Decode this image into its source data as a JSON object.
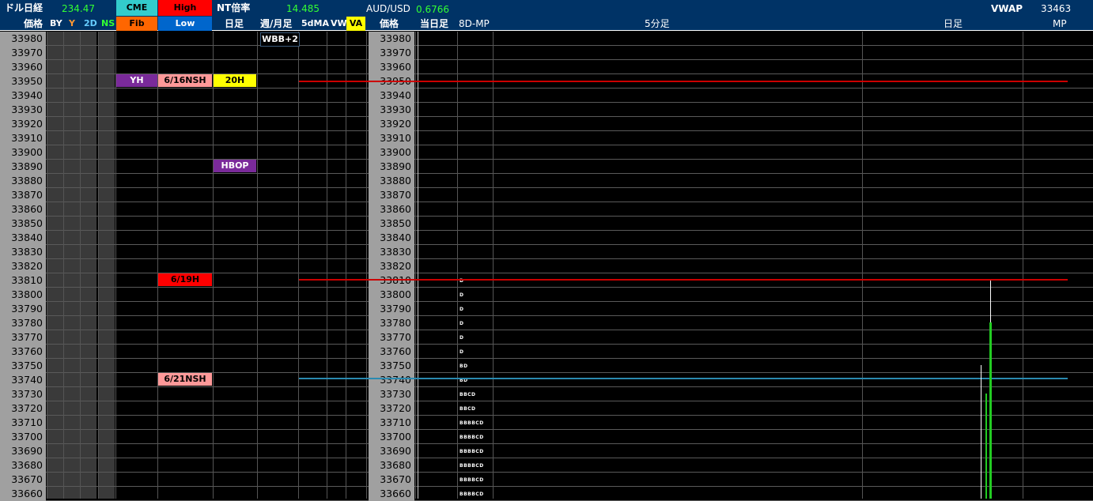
{
  "header": {
    "dollar_nikkei_label": "ドル日経",
    "dollar_nikkei_value": "234.47",
    "cme_label": "CME",
    "high_label": "High",
    "nt_label": "NT倍率",
    "nt_value": "14.485",
    "audusd_label": "AUD/USD",
    "audusd_value": "0.6766",
    "vwap_label": "VWAP",
    "vwap_value": "33463",
    "price_label": "価格",
    "by_label": "BY",
    "y_label": "Y",
    "twod_label": "2D",
    "ns_label": "NS",
    "fib_label": "Fib",
    "low_label": "Low",
    "daily_label": "日足",
    "weekly_label": "週/月足",
    "ma_label": "5dMA",
    "vw_label": "VW",
    "va_label": "VA",
    "price_label2": "価格",
    "today_label": "当日足",
    "mp8d_label": "8D-MP",
    "fivemin_label": "5分足",
    "daily_label2": "日足",
    "mp_label": "MP"
  },
  "prices": [
    "33980",
    "33970",
    "33960",
    "33950",
    "33940",
    "33930",
    "33920",
    "33910",
    "33900",
    "33890",
    "33880",
    "33870",
    "33860",
    "33850",
    "33840",
    "33830",
    "33820",
    "33810",
    "33800",
    "33790",
    "33780",
    "33770",
    "33760",
    "33750",
    "33740",
    "33730",
    "33720",
    "33710",
    "33700",
    "33690",
    "33680",
    "33670",
    "33660"
  ],
  "tags": {
    "wbb": "WBB+2",
    "yh": "YH",
    "ns616": "6/16NSH",
    "h20": "20H",
    "hbop": "HBOP",
    "h619": "6/19H",
    "ns621": "6/21NSH"
  },
  "mp_rows": {
    "r33810": "D",
    "r33800": "D",
    "r33790": "D",
    "r33780": "D",
    "r33770": "D",
    "r33760": "D",
    "r33750": "BD",
    "r33740": "BD",
    "r33730": "BBCD",
    "r33720": "BBCD",
    "r33710": "BBBBCD",
    "r33700": "BBBBCD",
    "r33690": "BBBBCD",
    "r33680": "BBBBCD",
    "r33670": "BBBBCD",
    "r33660": "BBBBCD"
  },
  "colors": {
    "header_bg": "#003366",
    "value_green": "#33ff33",
    "cme": "#33cccc",
    "high": "#ff0000",
    "fib": "#ff6600",
    "low": "#0066cc",
    "yh": "#7a2a9a",
    "nsh": "#ff9999",
    "h20": "#ffff00",
    "hbop": "#7a2a9a",
    "h619": "#ff0000",
    "red_line": "#cc0000",
    "blue_line": "#2a8ab0"
  }
}
